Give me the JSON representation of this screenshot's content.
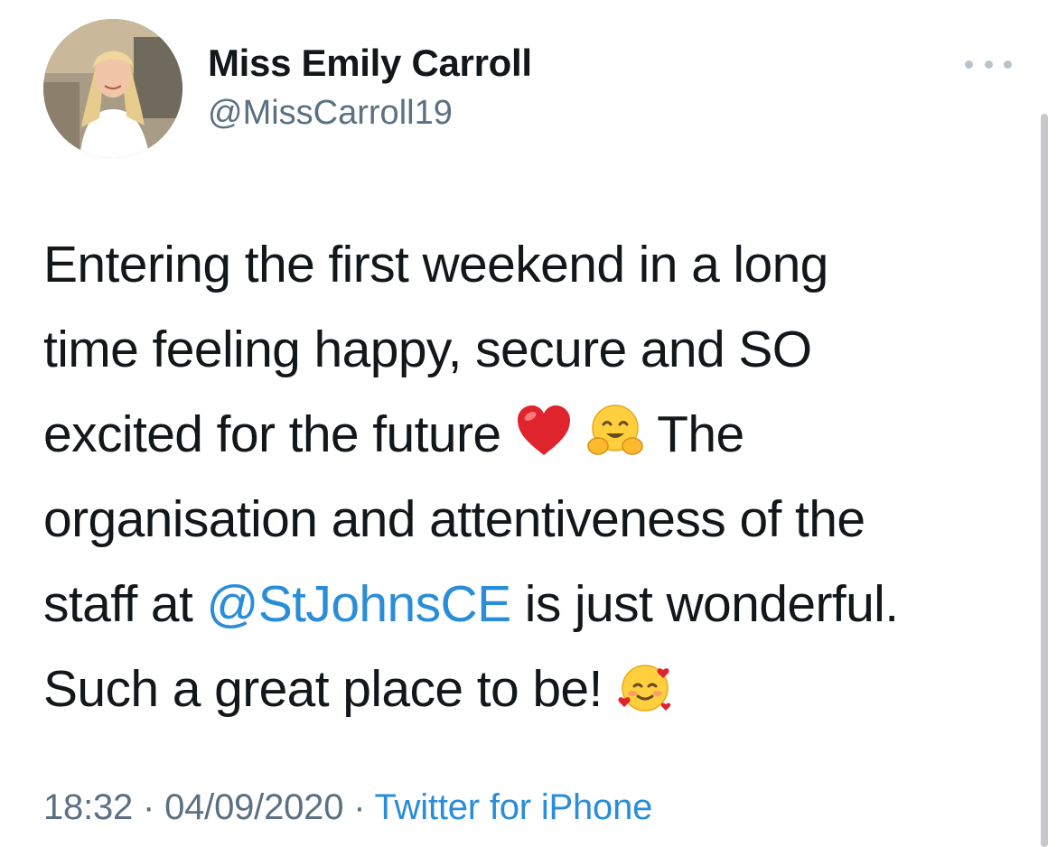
{
  "author": {
    "name": "Miss Emily Carroll",
    "handle": "@MissCarroll19"
  },
  "tweet": {
    "lines": [
      "Entering the first weekend in a long",
      "time feeling happy, secure and SO",
      "excited for the future",
      "The",
      "organisation and attentiveness of the",
      "staff at ",
      "@StJohnsCE",
      " is just wonderful.",
      "Such a great place to be!"
    ],
    "emojis": [
      "red-heart-emoji",
      "hugging-face-emoji",
      "smiling-face-with-hearts-emoji"
    ]
  },
  "meta": {
    "time": "18:32",
    "date": "04/09/2020",
    "separator": "·",
    "source": "Twitter for iPhone"
  },
  "colors": {
    "text": "#14171a",
    "secondary": "#5b7083",
    "link": "#2a8dd8"
  },
  "icons": {
    "more": "more-horizontal-icon"
  }
}
